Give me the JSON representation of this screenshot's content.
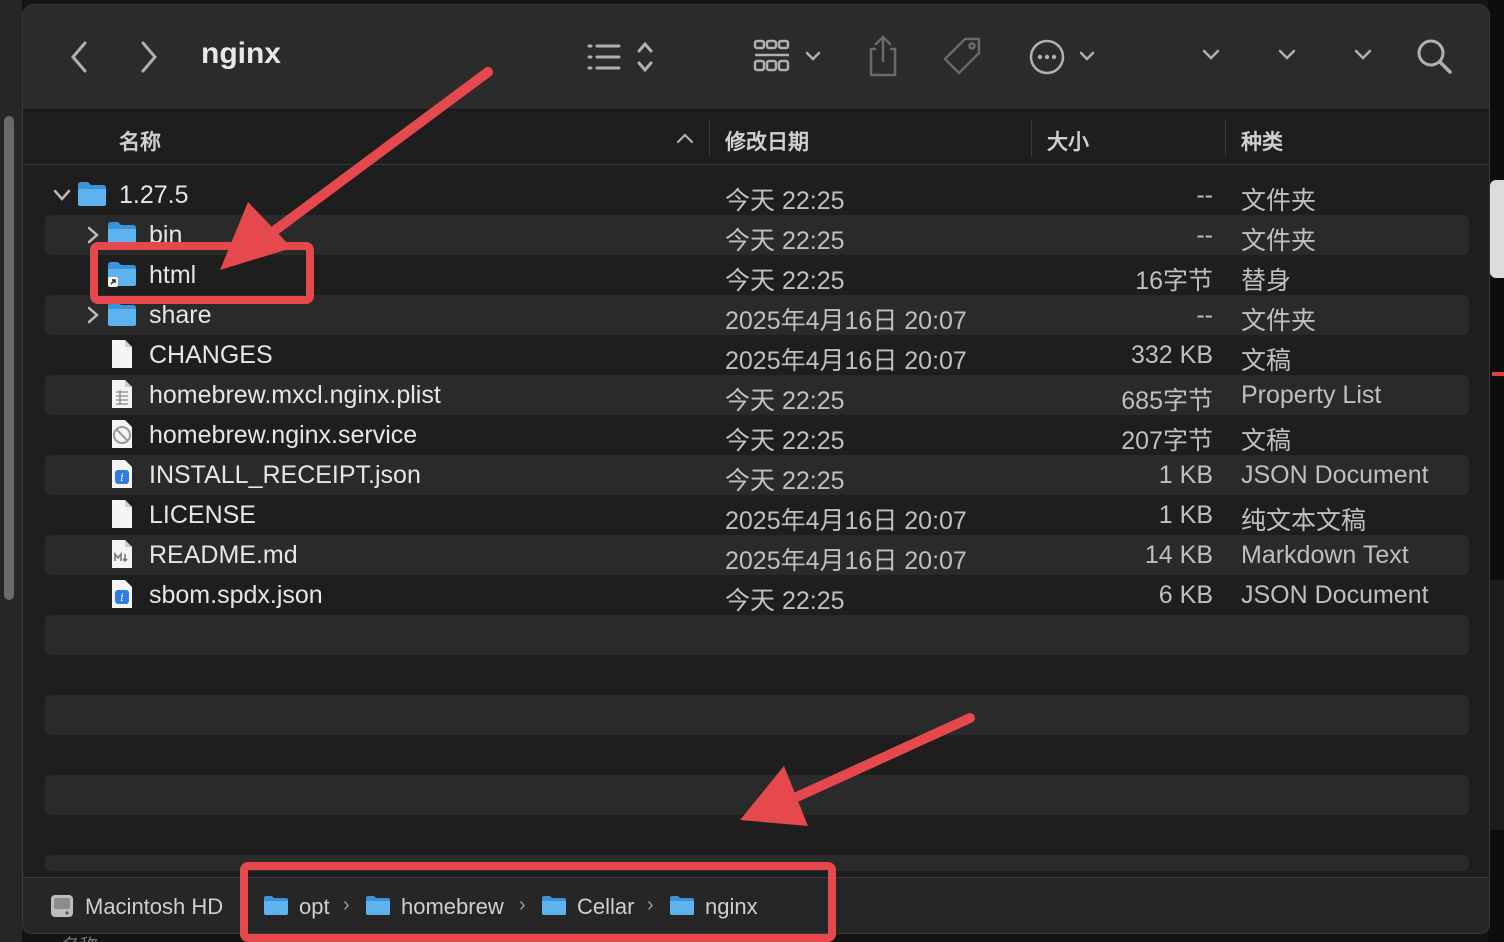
{
  "window": {
    "title": "nginx"
  },
  "columns": {
    "name": "名称",
    "modified": "修改日期",
    "size": "大小",
    "kind": "种类"
  },
  "files": [
    {
      "name": "1.27.5",
      "date": "今天 22:25",
      "size": "--",
      "kind": "文件夹",
      "icon": "folder-icon",
      "disclosure": "expanded"
    },
    {
      "name": "bin",
      "date": "今天 22:25",
      "size": "--",
      "kind": "文件夹",
      "icon": "folder-icon",
      "disclosure": "collapsed"
    },
    {
      "name": "html",
      "date": "今天 22:25",
      "size": "16字节",
      "kind": "替身",
      "icon": "alias-folder-icon",
      "disclosure": "none"
    },
    {
      "name": "share",
      "date": "2025年4月16日 20:07",
      "size": "--",
      "kind": "文件夹",
      "icon": "folder-icon",
      "disclosure": "collapsed"
    },
    {
      "name": "CHANGES",
      "date": "2025年4月16日 20:07",
      "size": "332 KB",
      "kind": "文稿",
      "icon": "document-icon",
      "disclosure": "none"
    },
    {
      "name": "homebrew.mxcl.nginx.plist",
      "date": "今天 22:25",
      "size": "685字节",
      "kind": "Property List",
      "icon": "plist-file-icon",
      "disclosure": "none"
    },
    {
      "name": "homebrew.nginx.service",
      "date": "今天 22:25",
      "size": "207字节",
      "kind": "文稿",
      "icon": "service-file-icon",
      "disclosure": "none"
    },
    {
      "name": "INSTALL_RECEIPT.json",
      "date": "今天 22:25",
      "size": "1 KB",
      "kind": "JSON Document",
      "icon": "json-file-icon",
      "disclosure": "none"
    },
    {
      "name": "LICENSE",
      "date": "2025年4月16日 20:07",
      "size": "1 KB",
      "kind": "纯文本文稿",
      "icon": "document-icon",
      "disclosure": "none"
    },
    {
      "name": "README.md",
      "date": "2025年4月16日 20:07",
      "size": "14 KB",
      "kind": "Markdown Text",
      "icon": "markdown-file-icon",
      "disclosure": "none"
    },
    {
      "name": "sbom.spdx.json",
      "date": "今天 22:25",
      "size": "6 KB",
      "kind": "JSON Document",
      "icon": "json-file-icon",
      "disclosure": "none"
    }
  ],
  "pathbar": {
    "disk": "Macintosh HD",
    "segments": [
      "opt",
      "homebrew",
      "Cellar",
      "nginx"
    ]
  },
  "colors": {
    "folder": "#4aa8e8",
    "annotation": "#e5484d",
    "accent_text": "#e6e6e6"
  },
  "backdrop": {
    "peek_text": "名称"
  }
}
